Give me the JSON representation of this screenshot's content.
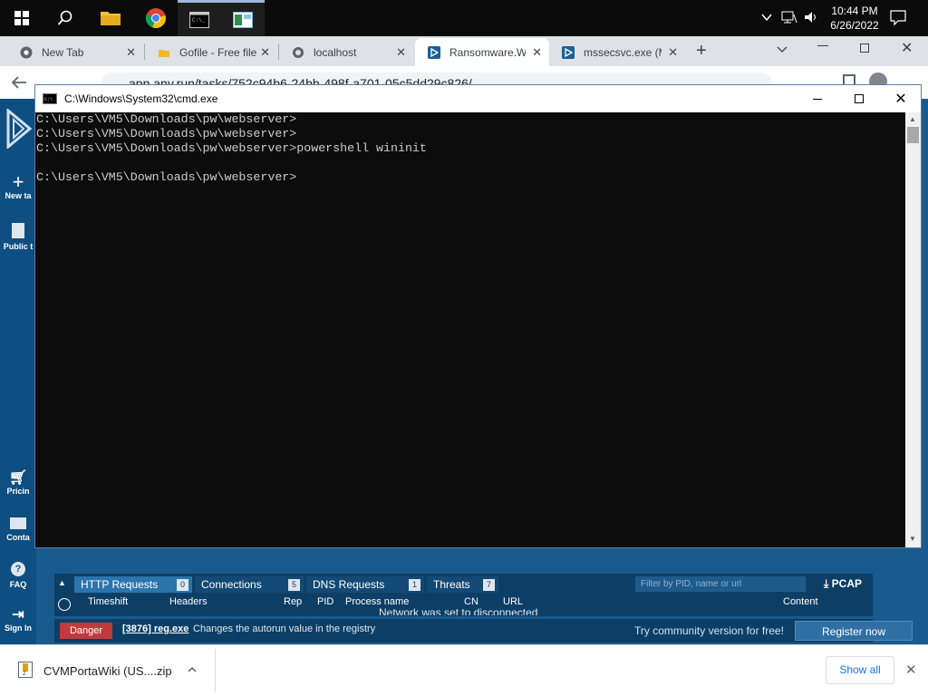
{
  "taskbar": {
    "time": "10:44 PM",
    "date": "6/26/2022"
  },
  "browser": {
    "tabs": [
      {
        "label": "New Tab"
      },
      {
        "label": "Gofile - Free file"
      },
      {
        "label": "localhost"
      },
      {
        "label": "Ransomware.W"
      },
      {
        "label": "mssecsvc.exe (M"
      }
    ],
    "url": "app.any.run/tasks/752c94b6-24bb-498f-a701-05c5dd29c826/"
  },
  "sidebar": {
    "items": [
      {
        "label": "New ta"
      },
      {
        "label": "Public t"
      },
      {
        "label": "Pricin"
      },
      {
        "label": "Conta"
      },
      {
        "label": "FAQ"
      },
      {
        "label": "Sign In"
      }
    ]
  },
  "cmd": {
    "title": "C:\\Windows\\System32\\cmd.exe",
    "console_text": "C:\\Users\\VM5\\Downloads\\pw\\webserver>\nC:\\Users\\VM5\\Downloads\\pw\\webserver>\nC:\\Users\\VM5\\Downloads\\pw\\webserver>powershell wininit\n\nC:\\Users\\VM5\\Downloads\\pw\\webserver>"
  },
  "network": {
    "tabs": [
      {
        "label": "HTTP Requests",
        "count": "0"
      },
      {
        "label": "Connections",
        "count": "5"
      },
      {
        "label": "DNS Requests",
        "count": "1"
      },
      {
        "label": "Threats",
        "count": "7"
      }
    ],
    "filter_placeholder": "Filter by PID, name or url",
    "pcap": "PCAP",
    "columns": [
      "Timeshift",
      "Headers",
      "Rep",
      "PID",
      "Process name",
      "CN",
      "URL",
      "Content"
    ],
    "message": "Network was set to disconnected"
  },
  "status": {
    "badge": "Danger",
    "process": "[3876] reg.exe",
    "description": "Changes the autorun value in the registry",
    "promo": "Try community version for free!",
    "register": "Register now"
  },
  "downloads": {
    "file": "CVMPortaWiki (US....zip",
    "show_all": "Show all"
  },
  "colors": {
    "accent": "#195b8e",
    "danger": "#c23a3a",
    "console_bg": "#0c0c0c"
  }
}
